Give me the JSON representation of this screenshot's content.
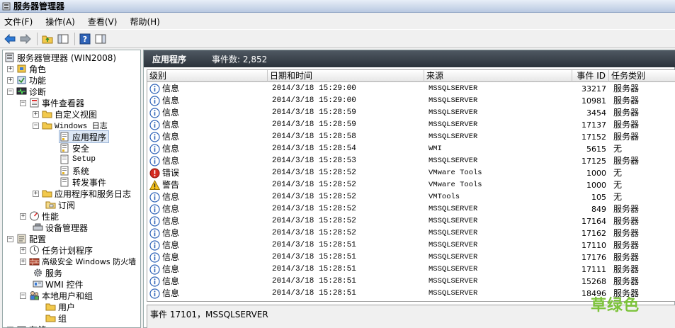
{
  "window": {
    "title": "服务器管理器"
  },
  "menu": [
    "文件(F)",
    "操作(A)",
    "查看(V)",
    "帮助(H)"
  ],
  "tree": {
    "root": "服务器管理器 (WIN2008)",
    "roles": "角色",
    "features": "功能",
    "diagnostics": "诊断",
    "event_viewer": "事件查看器",
    "custom_views": "自定义视图",
    "windows_logs": "Windows 日志",
    "application": "应用程序",
    "security": "安全",
    "setup": "Setup",
    "system": "系统",
    "forwarded": "转发事件",
    "app_service_logs": "应用程序和服务日志",
    "subscriptions": "订阅",
    "performance": "性能",
    "device_manager": "设备管理器",
    "configuration": "配置",
    "task_scheduler": "任务计划程序",
    "firewall": "高级安全 Windows 防火墙",
    "services": "服务",
    "wmi": "WMI 控件",
    "local_users": "本地用户和组",
    "users": "用户",
    "groups": "组",
    "storage": "存储"
  },
  "panel": {
    "title": "应用程序",
    "count_label": "事件数: 2,852"
  },
  "columns": [
    "级别",
    "日期和时间",
    "来源",
    "事件 ID",
    "任务类别"
  ],
  "rows": [
    {
      "level": "信息",
      "icon": "info",
      "date": "2014/3/18 15:29:00",
      "source": "MSSQLSERVER",
      "id": "33217",
      "cat": "服务器"
    },
    {
      "level": "信息",
      "icon": "info",
      "date": "2014/3/18 15:29:00",
      "source": "MSSQLSERVER",
      "id": "10981",
      "cat": "服务器"
    },
    {
      "level": "信息",
      "icon": "info",
      "date": "2014/3/18 15:28:59",
      "source": "MSSQLSERVER",
      "id": "3454",
      "cat": "服务器"
    },
    {
      "level": "信息",
      "icon": "info",
      "date": "2014/3/18 15:28:59",
      "source": "MSSQLSERVER",
      "id": "17137",
      "cat": "服务器"
    },
    {
      "level": "信息",
      "icon": "info",
      "date": "2014/3/18 15:28:58",
      "source": "MSSQLSERVER",
      "id": "17152",
      "cat": "服务器"
    },
    {
      "level": "信息",
      "icon": "info",
      "date": "2014/3/18 15:28:54",
      "source": "WMI",
      "id": "5615",
      "cat": "无"
    },
    {
      "level": "信息",
      "icon": "info",
      "date": "2014/3/18 15:28:53",
      "source": "MSSQLSERVER",
      "id": "17125",
      "cat": "服务器"
    },
    {
      "level": "错误",
      "icon": "error",
      "date": "2014/3/18 15:28:52",
      "source": "VMware Tools",
      "id": "1000",
      "cat": "无"
    },
    {
      "level": "警告",
      "icon": "warning",
      "date": "2014/3/18 15:28:52",
      "source": "VMware Tools",
      "id": "1000",
      "cat": "无"
    },
    {
      "level": "信息",
      "icon": "info",
      "date": "2014/3/18 15:28:52",
      "source": "VMTools",
      "id": "105",
      "cat": "无"
    },
    {
      "level": "信息",
      "icon": "info",
      "date": "2014/3/18 15:28:52",
      "source": "MSSQLSERVER",
      "id": "849",
      "cat": "服务器"
    },
    {
      "level": "信息",
      "icon": "info",
      "date": "2014/3/18 15:28:52",
      "source": "MSSQLSERVER",
      "id": "17164",
      "cat": "服务器"
    },
    {
      "level": "信息",
      "icon": "info",
      "date": "2014/3/18 15:28:52",
      "source": "MSSQLSERVER",
      "id": "17162",
      "cat": "服务器"
    },
    {
      "level": "信息",
      "icon": "info",
      "date": "2014/3/18 15:28:51",
      "source": "MSSQLSERVER",
      "id": "17110",
      "cat": "服务器"
    },
    {
      "level": "信息",
      "icon": "info",
      "date": "2014/3/18 15:28:51",
      "source": "MSSQLSERVER",
      "id": "17176",
      "cat": "服务器"
    },
    {
      "level": "信息",
      "icon": "info",
      "date": "2014/3/18 15:28:51",
      "source": "MSSQLSERVER",
      "id": "17111",
      "cat": "服务器"
    },
    {
      "level": "信息",
      "icon": "info",
      "date": "2014/3/18 15:28:51",
      "source": "MSSQLSERVER",
      "id": "15268",
      "cat": "服务器"
    },
    {
      "level": "信息",
      "icon": "info",
      "date": "2014/3/18 15:28:51",
      "source": "MSSQLSERVER",
      "id": "18496",
      "cat": "服务器"
    }
  ],
  "detail": {
    "header": "事件 17101，MSSQLSERVER"
  },
  "watermark": "草绿色"
}
